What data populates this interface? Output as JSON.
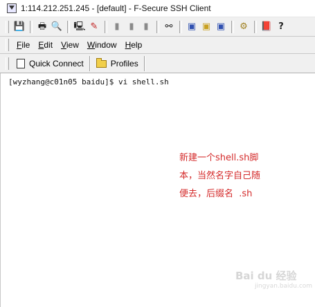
{
  "window": {
    "title": "1:114.212.251.245 - [default] - F-Secure SSH Client"
  },
  "toolbar": {
    "buttons": [
      {
        "icon": "save-icon",
        "glyph": "💾"
      },
      {
        "icon": "print-icon",
        "glyph": "🖶"
      },
      {
        "icon": "print-preview-icon",
        "glyph": "🔍"
      },
      {
        "icon": "disconnect-icon",
        "glyph": "🖳"
      },
      {
        "icon": "connect-icon",
        "glyph": "✎"
      },
      {
        "icon": "cut-icon",
        "glyph": "▮"
      },
      {
        "icon": "copy-icon",
        "glyph": "▮"
      },
      {
        "icon": "paste-icon",
        "glyph": "▮"
      },
      {
        "icon": "find-icon",
        "glyph": "⚯"
      },
      {
        "icon": "new-terminal-icon",
        "glyph": "▣"
      },
      {
        "icon": "new-file-transfer-icon",
        "glyph": "▣"
      },
      {
        "icon": "terminal-settings-icon",
        "glyph": "▣"
      },
      {
        "icon": "settings-icon",
        "glyph": "⚙"
      },
      {
        "icon": "help-book-icon",
        "glyph": "📕"
      },
      {
        "icon": "context-help-icon",
        "glyph": "?"
      }
    ]
  },
  "menu": {
    "file": {
      "u": "F",
      "rest": "ile"
    },
    "edit": {
      "u": "E",
      "rest": "dit"
    },
    "view": {
      "u": "V",
      "rest": "iew"
    },
    "window": {
      "u": "W",
      "rest": "indow"
    },
    "help": {
      "u": "H",
      "rest": "elp"
    }
  },
  "connection_bar": {
    "quick_connect": "Quick Connect",
    "profiles": "Profiles"
  },
  "terminal": {
    "line1": "[wyzhang@c01n05 baidu]$ vi shell.sh"
  },
  "annotation": {
    "line1": "新建一个shell.sh脚",
    "line2": "本，当然名字自己随",
    "line3": "便去，后缀名  .sh",
    "color": "#d42a2a"
  },
  "watermark": {
    "text": "Bai du 经验",
    "sub": "jingyan.baidu.com"
  }
}
